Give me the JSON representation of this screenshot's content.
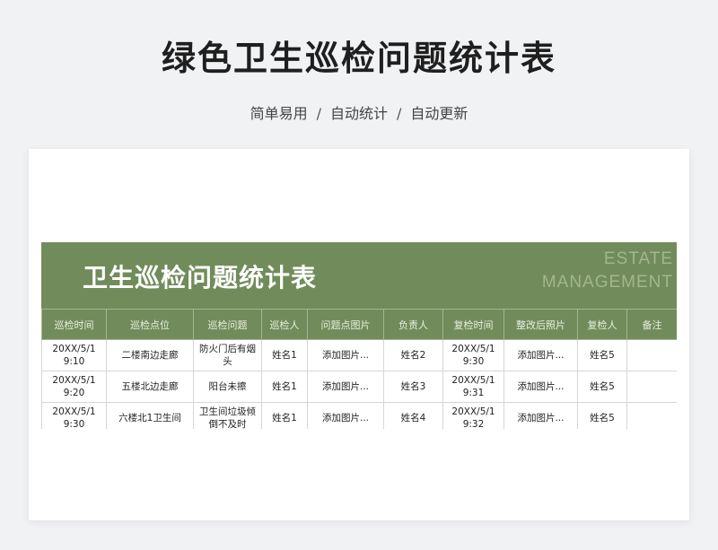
{
  "header": {
    "title": "绿色卫生巡检问题统计表",
    "tags": [
      "简单易用",
      "自动统计",
      "自动更新"
    ],
    "separator": "/"
  },
  "sheet": {
    "title": "卫生巡检问题统计表",
    "en_line1": "ESTATE",
    "en_line2": "MANAGEMENT",
    "columns": [
      "巡检时间",
      "巡检点位",
      "巡检问题",
      "巡检人",
      "问题点图片",
      "负责人",
      "复检时间",
      "整改后照片",
      "复检人",
      "备注"
    ],
    "rows": [
      [
        "20XX/5/1 9:10",
        "二楼南边走廊",
        "防火门后有烟头",
        "姓名1",
        "添加图片...",
        "姓名2",
        "20XX/5/1 9:30",
        "添加图片...",
        "姓名5",
        ""
      ],
      [
        "20XX/5/1 9:20",
        "五楼北边走廊",
        "阳台未擦",
        "姓名1",
        "添加图片...",
        "姓名3",
        "20XX/5/1 9:31",
        "添加图片...",
        "姓名5",
        ""
      ],
      [
        "20XX/5/1 9:30",
        "六楼北1卫生间",
        "卫生间垃圾倾倒不及时",
        "姓名1",
        "添加图片...",
        "姓名4",
        "20XX/5/1 9:32",
        "添加图片...",
        "姓名5",
        ""
      ]
    ]
  },
  "colors": {
    "banner": "#718c5a",
    "background": "#f1f2f4"
  }
}
